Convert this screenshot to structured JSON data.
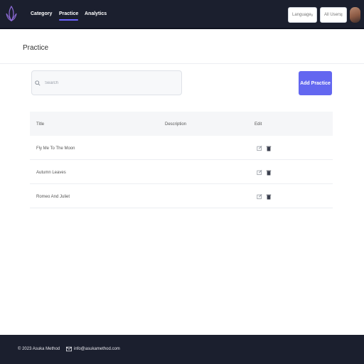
{
  "nav": {
    "items": [
      {
        "label": "Category"
      },
      {
        "label": "Practice",
        "active": true
      },
      {
        "label": "Analytics"
      }
    ],
    "language_select": "Language",
    "users_select": "All Users"
  },
  "page": {
    "title": "Practice"
  },
  "search": {
    "placeholder": "Search",
    "value": ""
  },
  "toolbar": {
    "add_label": "Add Practice"
  },
  "table": {
    "columns": [
      "Title",
      "Description",
      "Edit"
    ],
    "rows": [
      {
        "title": "Fly Me To The Moon",
        "description": ""
      },
      {
        "title": "Autumn Leaves",
        "description": ""
      },
      {
        "title": "Romeo And Juliet",
        "description": ""
      }
    ]
  },
  "footer": {
    "copyright": "© 2023 Asuka Method",
    "email": "info@asukamethod.com"
  },
  "colors": {
    "nav_bg": "#1b1f2e",
    "accent": "#6367f0"
  },
  "icons": {
    "logo": "lotus-logo-icon",
    "search": "search-icon",
    "edit": "edit-icon",
    "delete": "trash-icon",
    "mail": "mail-icon",
    "caret": "chevron-down-icon"
  }
}
